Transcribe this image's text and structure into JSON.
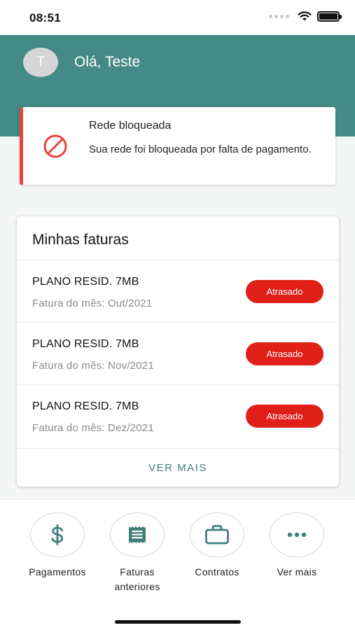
{
  "status_bar": {
    "time": "08:51"
  },
  "header": {
    "avatar_initial": "T",
    "greeting": "Olá, Teste",
    "background_color": "#448a86"
  },
  "alert": {
    "icon": "blocked-icon",
    "title": "Rede bloqueada",
    "message": "Sua rede foi bloqueada por falta de pagamento.",
    "accent_color": "#e8433b"
  },
  "invoices": {
    "title": "Minhas faturas",
    "items": [
      {
        "plan": "PLANO RESID. 7MB",
        "month": "Fatura do mês: Out/2021",
        "status": "Atrasado"
      },
      {
        "plan": "PLANO RESID. 7MB",
        "month": "Fatura do mês: Nov/2021",
        "status": "Atrasado"
      },
      {
        "plan": "PLANO RESID. 7MB",
        "month": "Fatura do mês: Dez/2021",
        "status": "Atrasado"
      }
    ],
    "status_color": "#e01f18",
    "see_more": "VER MAIS"
  },
  "actions": [
    {
      "icon": "dollar-icon",
      "label": "Pagamentos"
    },
    {
      "icon": "receipt-icon",
      "label": "Faturas anteriores"
    },
    {
      "icon": "briefcase-icon",
      "label": "Contratos"
    },
    {
      "icon": "more-dots-icon",
      "label": "Ver mais"
    }
  ]
}
